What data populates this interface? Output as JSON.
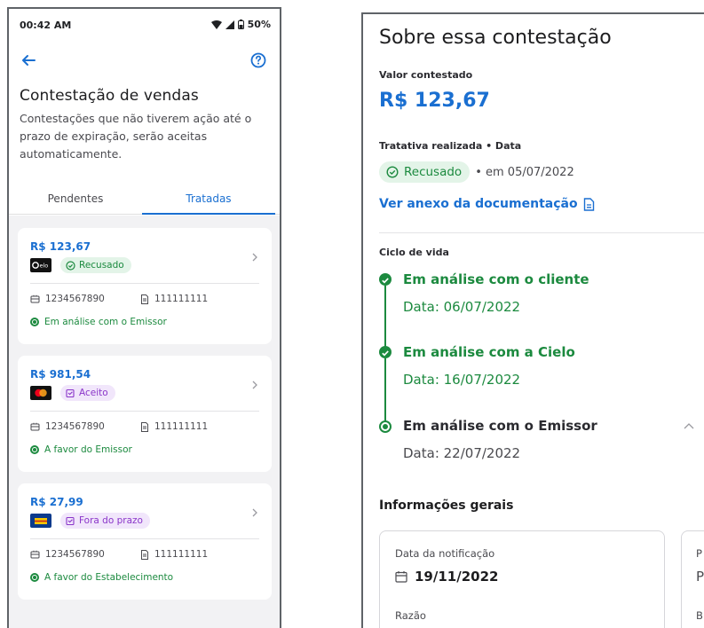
{
  "left_screen": {
    "status_bar": {
      "time": "00:42 AM",
      "battery": "50%"
    },
    "title": "Contestação de vendas",
    "subtitle": "Contestações que não tiverem ação até o prazo de expiração, serão aceitas automaticamente.",
    "tabs": [
      {
        "label": "Pendentes",
        "active": false
      },
      {
        "label": "Tratadas",
        "active": true
      }
    ],
    "cards": [
      {
        "amount": "R$ 123,67",
        "brand": "elo",
        "badge": "Recusado",
        "badge_color": "#1c8a3f",
        "code": "1234567890",
        "doc": "111111111",
        "status": "Em análise com o Emissor"
      },
      {
        "amount": "R$ 981,54",
        "brand": "mastercard",
        "badge": "Aceito",
        "badge_color": "#8a35c9",
        "code": "1234567890",
        "doc": "111111111",
        "status": "A favor do Emissor"
      },
      {
        "amount": "R$ 27,99",
        "brand": "banco",
        "badge": "Fora do prazo",
        "badge_color": "#8a35c9",
        "code": "1234567890",
        "doc": "111111111",
        "status": "A favor do Estabelecimento"
      }
    ]
  },
  "right_screen": {
    "title": "Sobre essa contestação",
    "value_label": "Valor contestado",
    "value": "R$ 123,67",
    "treatment_label": "Tratativa realizada • Data",
    "treatment_badge": "Recusado",
    "treatment_date": "• em 05/07/2022",
    "doc_link": "Ver anexo da documentação",
    "lifecycle_label": "Ciclo de vida",
    "lifecycle": [
      {
        "title": "Em análise com o cliente",
        "date": "Data: 06/07/2022",
        "state": "done"
      },
      {
        "title": "Em análise com a Cielo",
        "date": "Data: 16/07/2022",
        "state": "done"
      },
      {
        "title": "Em análise com o Emissor",
        "date": "Data: 22/07/2022",
        "state": "current"
      }
    ],
    "general_info_label": "Informações gerais",
    "info_card": {
      "notification_label": "Data da notificação",
      "notification_date": "19/11/2022",
      "reason_label": "Razão"
    },
    "info_card_2": {
      "line1": "P",
      "line2": "P",
      "line3": "B"
    }
  },
  "colors": {
    "accent_blue": "#1a6fd1",
    "success_green": "#1c8a3f",
    "purple": "#8a35c9"
  }
}
